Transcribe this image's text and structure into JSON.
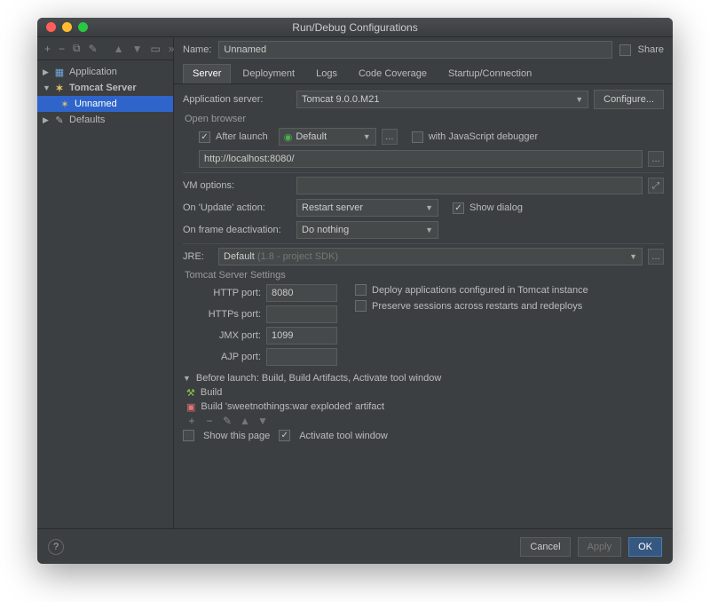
{
  "window": {
    "title": "Run/Debug Configurations"
  },
  "header": {
    "name_label": "Name:",
    "name_value": "Unnamed",
    "share_label": "Share"
  },
  "tree": {
    "application": "Application",
    "tomcat_server": "Tomcat Server",
    "unnamed": "Unnamed",
    "defaults": "Defaults"
  },
  "tabs": {
    "server": "Server",
    "deployment": "Deployment",
    "logs": "Logs",
    "code_coverage": "Code Coverage",
    "startup": "Startup/Connection"
  },
  "server": {
    "app_server_label": "Application server:",
    "app_server_value": "Tomcat 9.0.0.M21",
    "configure_btn": "Configure...",
    "open_browser_title": "Open browser",
    "after_launch_label": "After launch",
    "browser_value": "Default",
    "js_debugger_label": "with JavaScript debugger",
    "url_value": "http://localhost:8080/",
    "vm_options_label": "VM options:",
    "update_action_label": "On 'Update' action:",
    "update_action_value": "Restart server",
    "show_dialog_label": "Show dialog",
    "frame_deact_label": "On frame deactivation:",
    "frame_deact_value": "Do nothing",
    "jre_label": "JRE:",
    "jre_value": "Default",
    "jre_hint": "(1.8 - project SDK)",
    "tomcat_settings_title": "Tomcat Server Settings",
    "http_port_label": "HTTP port:",
    "http_port_value": "8080",
    "https_port_label": "HTTPs port:",
    "jmx_port_label": "JMX port:",
    "jmx_port_value": "1099",
    "ajp_port_label": "AJP port:",
    "deploy_apps_label": "Deploy applications configured in Tomcat instance",
    "preserve_sessions_label": "Preserve sessions across restarts and redeploys"
  },
  "before_launch": {
    "title": "Before launch: Build, Build Artifacts, Activate tool window",
    "item1": "Build",
    "item2": "Build 'sweetnothings:war exploded' artifact",
    "show_page_label": "Show this page",
    "activate_label": "Activate tool window"
  },
  "footer": {
    "cancel": "Cancel",
    "apply": "Apply",
    "ok": "OK"
  }
}
